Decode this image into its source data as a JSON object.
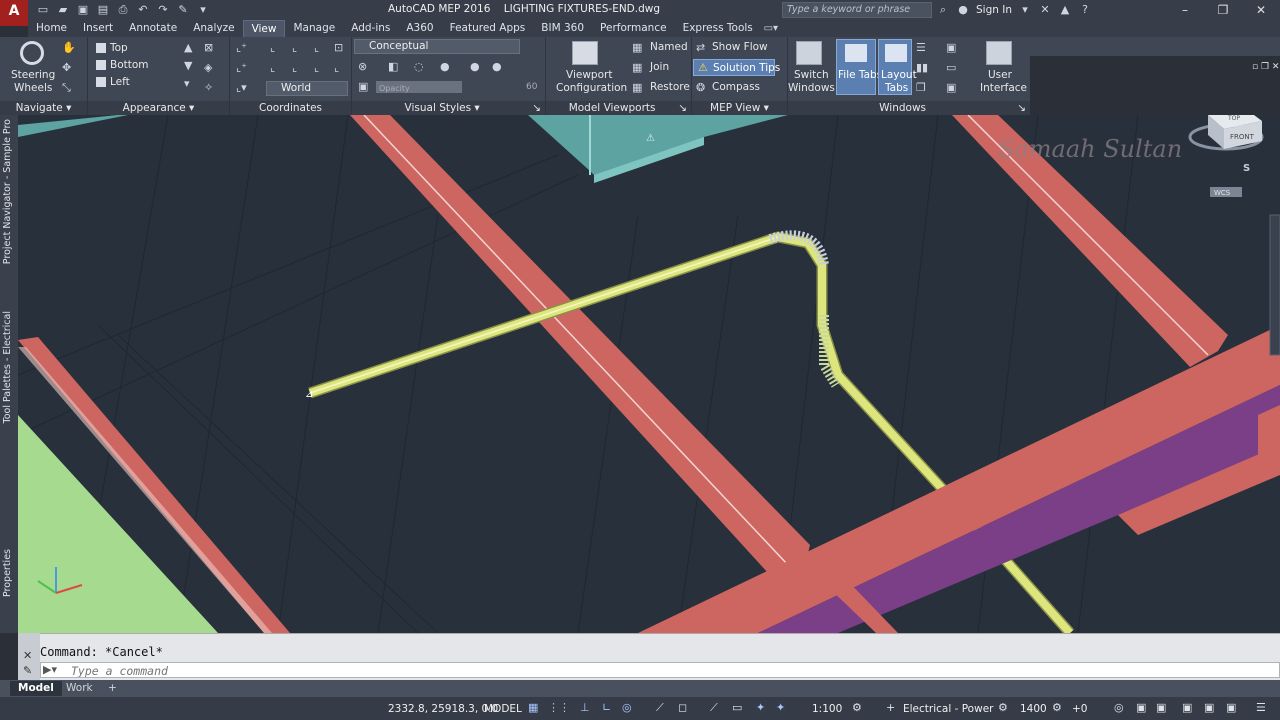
{
  "titlebar": {
    "app_logo": "A",
    "app_logo_sub": "MEP",
    "title": "AutoCAD MEP 2016    LIGHTING FIXTURES-END.dwg",
    "search_placeholder": "Type a keyword or phrase",
    "sign_in": "Sign In"
  },
  "tabs": [
    {
      "label": "Home"
    },
    {
      "label": "Insert"
    },
    {
      "label": "Annotate"
    },
    {
      "label": "Analyze"
    },
    {
      "label": "View",
      "active": true
    },
    {
      "label": "Manage"
    },
    {
      "label": "Add-ins"
    },
    {
      "label": "A360"
    },
    {
      "label": "Featured Apps"
    },
    {
      "label": "BIM 360"
    },
    {
      "label": "Performance"
    },
    {
      "label": "Express Tools"
    }
  ],
  "ribbon": {
    "navigate": {
      "title": "Navigate",
      "steering_wheels": "Steering",
      "steering_wheels_2": "Wheels"
    },
    "appearance": {
      "title": "Appearance",
      "views": [
        "Top",
        "Bottom",
        "Left"
      ]
    },
    "coordinates": {
      "title": "Coordinates",
      "ucs": "World"
    },
    "visual_styles": {
      "title": "Visual Styles",
      "style": "Conceptual",
      "opacity_value": "60",
      "opacity_label": "Opacity"
    },
    "model_viewports": {
      "title": "Model Viewports",
      "viewport_config_1": "Viewport",
      "viewport_config_2": "Configuration",
      "named": "Named",
      "join": "Join",
      "restore": "Restore"
    },
    "mep_view": {
      "title": "MEP View",
      "show_flow": "Show Flow",
      "solution_tips": "Solution Tips",
      "compass": "Compass"
    },
    "windows": {
      "title": "Windows",
      "switch_windows_1": "Switch",
      "switch_windows_2": "Windows",
      "file_tabs_1": "File Tabs",
      "layout_tabs_1": "Layout",
      "layout_tabs_2": "Tabs",
      "user_interface_1": "User",
      "user_interface_2": "Interface"
    }
  },
  "palettes": {
    "project_navigator": "Project Navigator - Sample Pro",
    "tool_palettes": "Tool Palettes - Electrical",
    "properties": "Properties"
  },
  "viewcube": {
    "top": "TOP",
    "front": "FRONT",
    "compass_s": "S",
    "wcs": "WCS"
  },
  "watermark": "Samaah Sultan",
  "command": {
    "history": "Command: *Cancel*",
    "placeholder": "Type a command"
  },
  "layout_tabs": [
    {
      "label": "Model",
      "active": true
    },
    {
      "label": "Work"
    }
  ],
  "status": {
    "coords": "2332.8, 25918.3, 0.0",
    "space": "MODEL",
    "scale": "1:100",
    "config": "Electrical - Power",
    "elevation": "1400",
    "offset": "+0"
  },
  "colors": {
    "beam": "#cd6660",
    "duct": "#5da3a1",
    "conduit": "#dde57d",
    "purple_beam": "#7a3f86",
    "floor": "#a6db8f",
    "background": "#27303b"
  }
}
